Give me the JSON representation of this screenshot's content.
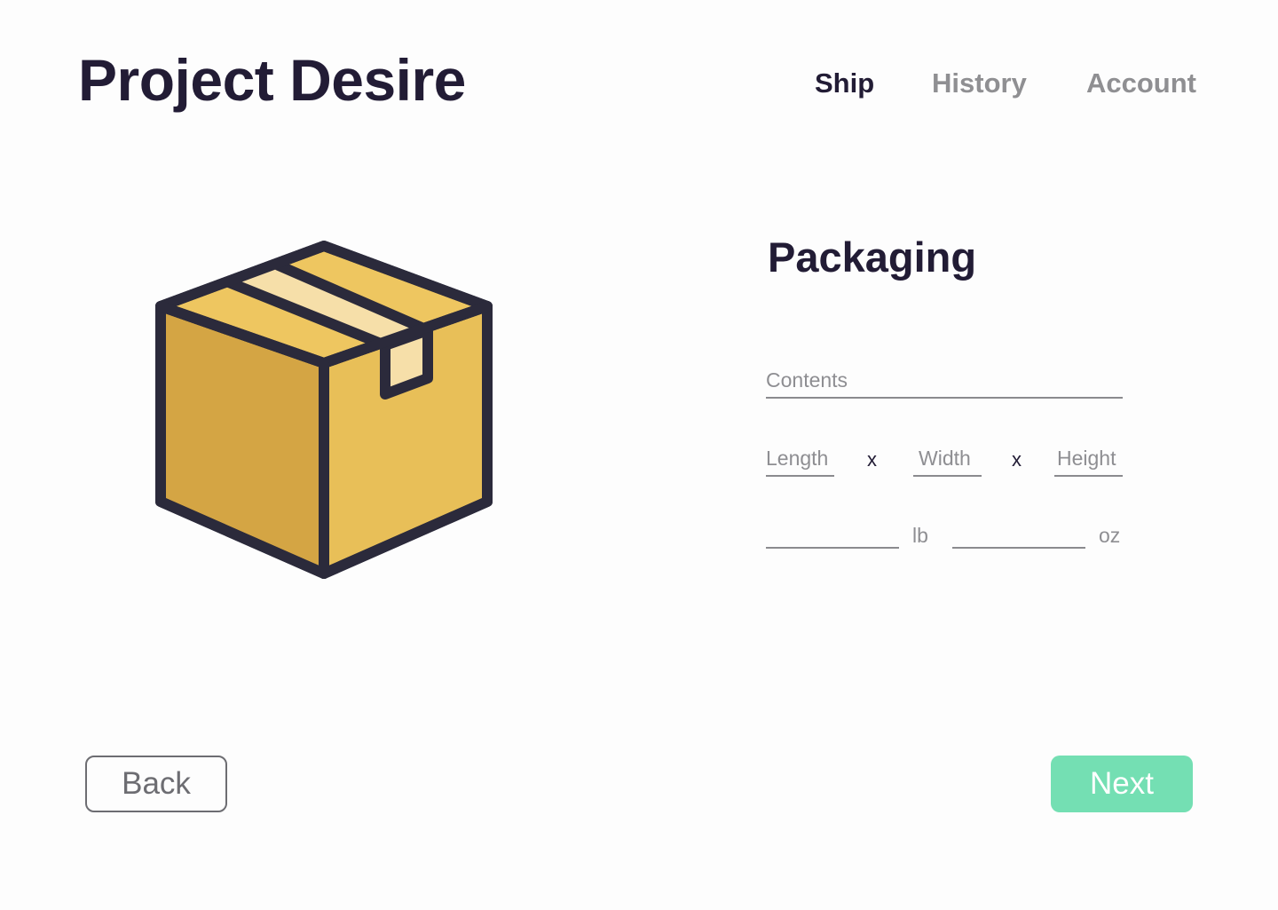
{
  "app": {
    "title": "Project Desire"
  },
  "nav": {
    "items": [
      {
        "label": "Ship",
        "active": true
      },
      {
        "label": "History",
        "active": false
      },
      {
        "label": "Account",
        "active": false
      }
    ]
  },
  "illustration": {
    "icon": "package-box-icon",
    "colors": {
      "outline": "#2b2a3b",
      "left_face": "#d4a544",
      "right_face": "#e8bf58",
      "top_face": "#eec660",
      "tape": "#f6dfa9"
    }
  },
  "form": {
    "title": "Packaging",
    "contents": {
      "placeholder": "Contents",
      "value": ""
    },
    "dimensions": {
      "length": {
        "placeholder": "Length",
        "value": ""
      },
      "width": {
        "placeholder": "Width",
        "value": ""
      },
      "height": {
        "placeholder": "Height",
        "value": ""
      },
      "separator": "x"
    },
    "weight": {
      "pounds": {
        "value": "",
        "unit": "lb"
      },
      "ounces": {
        "value": "",
        "unit": "oz"
      }
    }
  },
  "actions": {
    "back_label": "Back",
    "next_label": "Next"
  },
  "colors": {
    "text_primary": "#221c35",
    "text_muted": "#8f8f92",
    "accent": "#74dfb3"
  }
}
